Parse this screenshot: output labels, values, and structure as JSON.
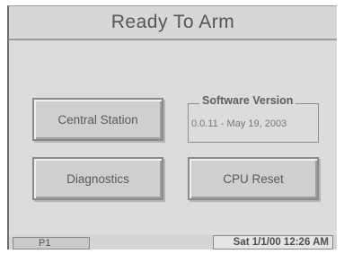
{
  "header": {
    "title": "Ready To Arm"
  },
  "buttons": {
    "central_station": "Central Station",
    "diagnostics": "Diagnostics",
    "cpu_reset": "CPU Reset"
  },
  "software": {
    "label": "Software Version",
    "value": "0.0.11 - May 19, 2003"
  },
  "status_bar": {
    "page": "P1",
    "datetime": "Sat 1/1/00 12:26 AM"
  }
}
